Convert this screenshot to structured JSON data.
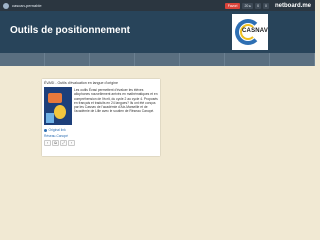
{
  "topbar": {
    "username": "cascan-pernable",
    "favorite_label": "Favori",
    "views": "20 ▸",
    "likes": "0",
    "comments": "0",
    "brand": "netboard.me"
  },
  "header": {
    "title": "Outils de positionnement",
    "logo_text": "CASNAV"
  },
  "card": {
    "title": "ÉVASI - Outils d'évaluation en langue d'origine",
    "description": "Les outils Évasi permettent d'évaluer les élèves allophones nouvellement arrivés en mathématiques et en compréhension de l'écrit, du cycle 2 au cycle 4. Proposés en français et traduits en 24 langues? Ils ont été conçus par les Casnav de l'académie d'Aix-Marseille et de l'académie de Lille avec le soutien de Réseau Canopé.",
    "original_label": "Original link",
    "author": "Réseau-Canopé",
    "actions": [
      "‹",
      "⧉",
      "⤢",
      "›"
    ]
  },
  "colors": {
    "topbar": "#2b3640",
    "header": "#28445a",
    "nav": "#5a6f80",
    "background": "#f1e9d3",
    "accent": "#2e6fb3"
  }
}
